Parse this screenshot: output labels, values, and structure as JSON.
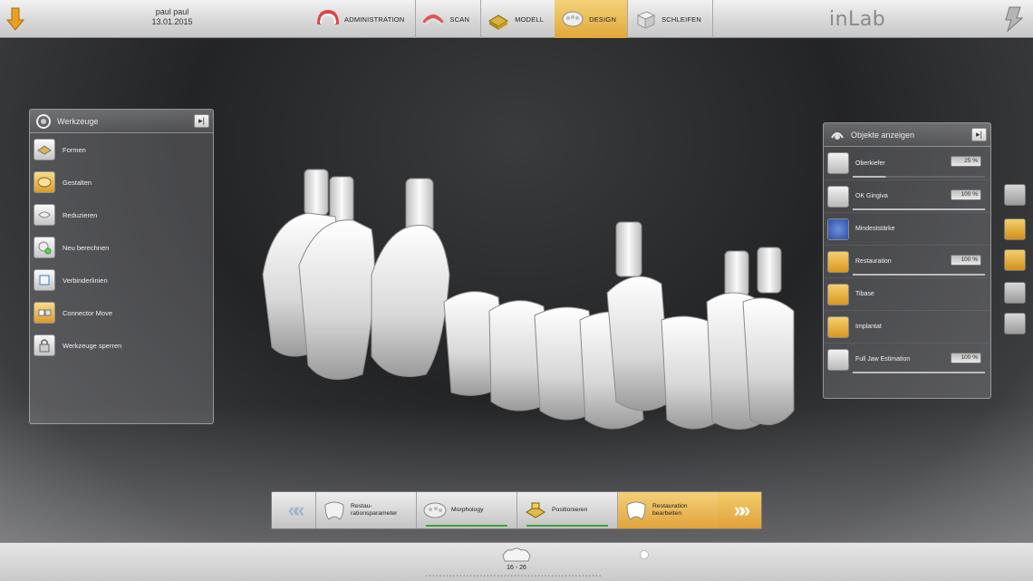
{
  "header": {
    "user_name": "paul paul",
    "date": "13.01.2015",
    "brand": "inLab",
    "nav": [
      {
        "label": "ADMINISTRATION",
        "active": false
      },
      {
        "label": "SCAN",
        "active": false
      },
      {
        "label": "MODELL",
        "active": false
      },
      {
        "label": "DESIGN",
        "active": true
      },
      {
        "label": "SCHLEIFEN",
        "active": false
      }
    ]
  },
  "tools_panel": {
    "title": "Werkzeuge",
    "items": [
      {
        "label": "Formen",
        "icon": "shape-icon"
      },
      {
        "label": "Gestalten",
        "icon": "design-icon"
      },
      {
        "label": "Reduzieren",
        "icon": "reduce-icon"
      },
      {
        "label": "Neu berechnen",
        "icon": "recalculate-icon"
      },
      {
        "label": "Verbinderlinien",
        "icon": "connector-lines-icon"
      },
      {
        "label": "Connector Move",
        "icon": "connector-move-icon"
      },
      {
        "label": "Werkzeuge sperren",
        "icon": "lock-icon"
      }
    ]
  },
  "objects_panel": {
    "title": "Objekte anzeigen",
    "items": [
      {
        "label": "Oberkiefer",
        "value": "25 %",
        "level": 0.25
      },
      {
        "label": "OK Gingiva",
        "value": "100 %",
        "level": 1.0
      },
      {
        "label": "Mindeststärke",
        "value": "",
        "level": null
      },
      {
        "label": "Restauration",
        "value": "100 %",
        "level": 1.0
      },
      {
        "label": "Tibase",
        "value": "",
        "level": null
      },
      {
        "label": "Implantat",
        "value": "",
        "level": null
      },
      {
        "label": "Full Jaw Estimation",
        "value": "100 %",
        "level": 1.0
      }
    ]
  },
  "workflow": {
    "back_glyph": "«",
    "forward_glyph": "»",
    "steps": [
      {
        "label": "Restau-\nrationsparameter",
        "active": false,
        "done": false
      },
      {
        "label": "Morphology",
        "active": false,
        "done": true
      },
      {
        "label": "Positionieren",
        "active": false,
        "done": true
      },
      {
        "label": "Restauration bearbeiten",
        "active": true,
        "done": false
      }
    ]
  },
  "status": {
    "range": "16 - 26"
  },
  "colors": {
    "accent": "#e0a83a",
    "progress": "#3ea23a",
    "background": "#2a2b2d"
  }
}
